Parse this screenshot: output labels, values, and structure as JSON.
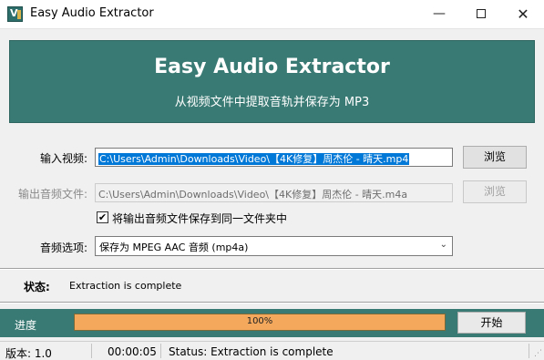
{
  "window": {
    "title": "Easy Audio Extractor",
    "minimize_glyph": "—",
    "close_glyph": "✕",
    "icon_letter": "V"
  },
  "banner": {
    "title": "Easy Audio Extractor",
    "subtitle": "从视频文件中提取音轨并保存为 MP3",
    "background_color": "#3a7a74"
  },
  "form": {
    "input_label": "输入视频:",
    "input_value": "C:\\Users\\Admin\\Downloads\\Video\\【4K修复】周杰伦 - 晴天.mp4",
    "input_browse_label": "浏览",
    "output_label": "输出音频文件:",
    "output_value": "C:\\Users\\Admin\\Downloads\\Video\\【4K修复】周杰伦 - 晴天.m4a",
    "output_browse_label": "浏览",
    "same_folder_checked": true,
    "same_folder_label": "将输出音频文件保存到同一文件夹中",
    "check_glyph": "✔",
    "audio_option_label": "音频选项:",
    "audio_option_value": "保存为 MPEG AAC 音频 (mp4a)",
    "dropdown_arrow": "⌄"
  },
  "status": {
    "label": "状态:",
    "text": "Extraction is complete"
  },
  "progress": {
    "label": "进度",
    "percent": 100,
    "percent_text": "100%",
    "start_label": "开始"
  },
  "statusbar": {
    "version": "版本: 1.0",
    "elapsed": "00:00:05",
    "status": "Status: Extraction is complete"
  }
}
